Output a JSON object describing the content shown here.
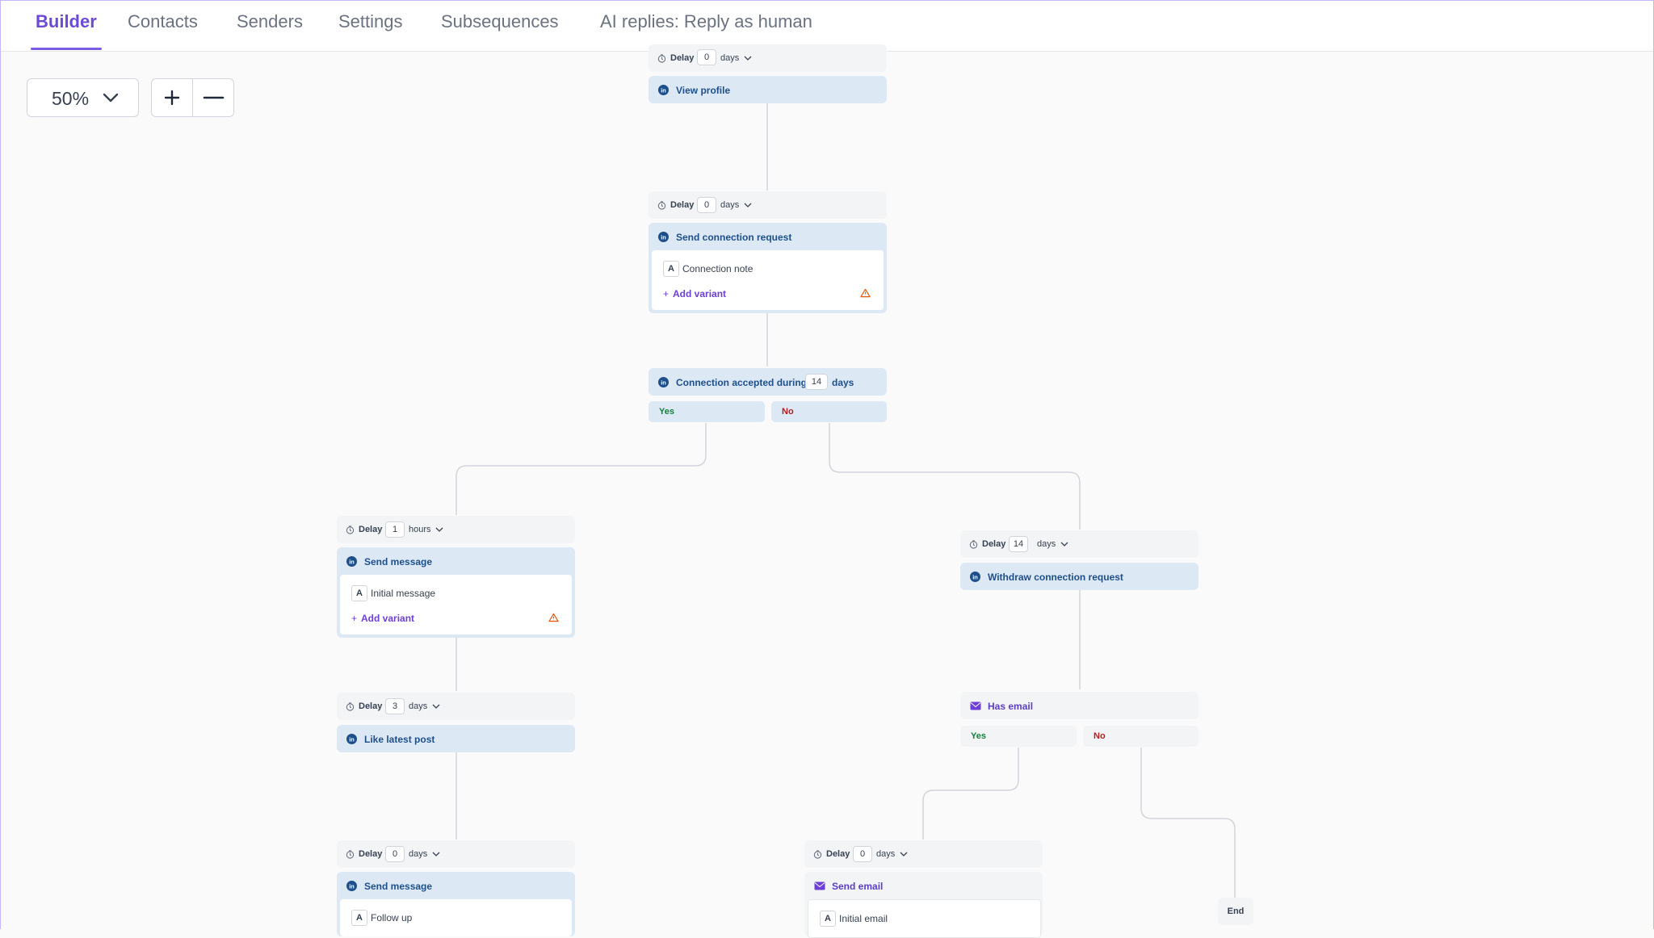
{
  "tabs": [
    {
      "label": "Builder",
      "active": true
    },
    {
      "label": "Contacts"
    },
    {
      "label": "Senders"
    },
    {
      "label": "Settings"
    },
    {
      "label": "Subsequences"
    },
    {
      "label": "AI replies: Reply as human"
    }
  ],
  "zoom": {
    "value": "50%",
    "plus": "+",
    "minus": "—"
  },
  "colors": {
    "accent": "#6d4ad6",
    "linkedin": "#1e4f8b",
    "action_bg": "#dce9f5",
    "yes": "#15803d",
    "no": "#b91c1c",
    "warning": "#ea580c"
  },
  "nodes": {
    "n1": {
      "delay_label": "Delay",
      "delay_value": "0",
      "delay_unit": "days",
      "action": "View profile",
      "icon": "linkedin-icon"
    },
    "n2": {
      "delay_label": "Delay",
      "delay_value": "0",
      "delay_unit": "days",
      "action": "Send connection request",
      "icon": "linkedin-icon",
      "variant_badge": "A",
      "variant": "Connection note",
      "add_variant": "Add variant"
    },
    "cond1": {
      "label": "Connection accepted during",
      "value": "14",
      "unit": "days",
      "yes": "Yes",
      "no": "No"
    },
    "n3": {
      "delay_label": "Delay",
      "delay_value": "1",
      "delay_unit": "hours",
      "action": "Send message",
      "icon": "linkedin-icon",
      "variant_badge": "A",
      "variant": "Initial message",
      "add_variant": "Add variant"
    },
    "n4": {
      "delay_label": "Delay",
      "delay_value": "14",
      "delay_unit": "days",
      "action": "Withdraw connection request",
      "icon": "linkedin-icon"
    },
    "n5": {
      "delay_label": "Delay",
      "delay_value": "3",
      "delay_unit": "days",
      "action": "Like latest post",
      "icon": "linkedin-icon"
    },
    "cond2": {
      "label": "Has email",
      "icon": "mail-icon",
      "yes": "Yes",
      "no": "No"
    },
    "n6": {
      "delay_label": "Delay",
      "delay_value": "0",
      "delay_unit": "days",
      "action": "Send message",
      "icon": "linkedin-icon",
      "variant_badge": "A",
      "variant": "Follow up"
    },
    "n7": {
      "delay_label": "Delay",
      "delay_value": "0",
      "delay_unit": "days",
      "action": "Send email",
      "icon": "mail-icon",
      "variant_badge": "A",
      "variant": "Initial email"
    },
    "end": {
      "label": "End"
    }
  }
}
